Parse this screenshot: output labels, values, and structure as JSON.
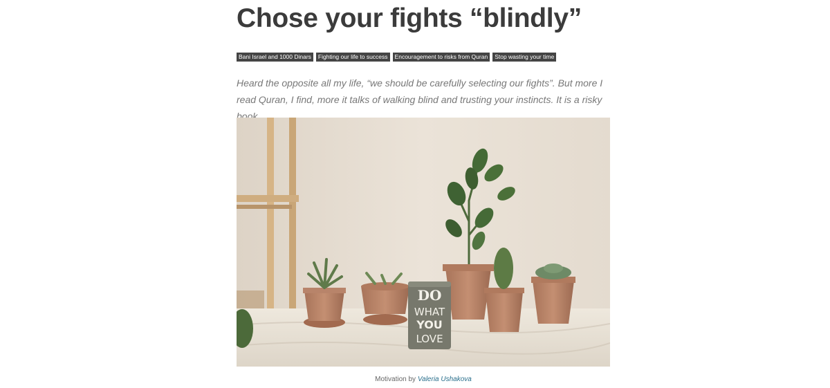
{
  "article": {
    "title": "Chose your fights “blindly”",
    "tags": [
      "Bani Israel and 1000 Dinars",
      "Fighting our life to success",
      "Encouragement to risks from Quran",
      "Stop wasting your time"
    ],
    "excerpt": "Heard the opposite all my life, “we should be carefully selecting our fights”. But more I read Quran, I find, more it talks of walking blind and trusting your instincts. It is a risky book.",
    "image": {
      "block_line1": "DO",
      "block_line2": "WHAT",
      "block_line3": "YOU",
      "block_line4": "LOVE"
    },
    "caption": {
      "prefix": "Motivation by",
      "author": "Valeria Ushakova"
    }
  }
}
